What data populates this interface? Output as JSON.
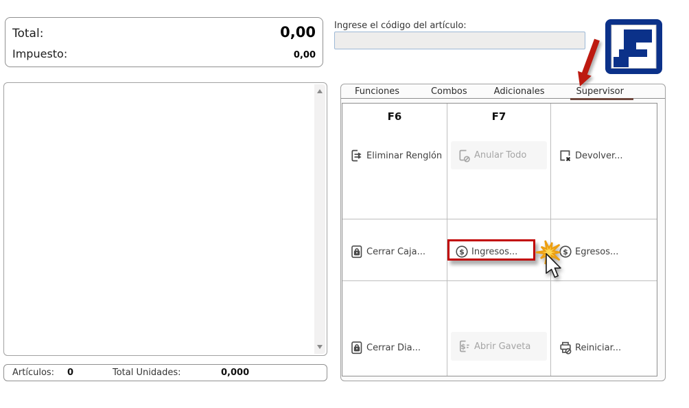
{
  "summary": {
    "total_label": "Total:",
    "total_value": "0,00",
    "tax_label": "Impuesto:",
    "tax_value": "0,00"
  },
  "code_entry": {
    "label": "Ingrese el código del artículo:",
    "value": ""
  },
  "tabs": [
    {
      "label": "Funciones",
      "selected": false
    },
    {
      "label": "Combos",
      "selected": false
    },
    {
      "label": "Adicionales",
      "selected": false
    },
    {
      "label": "Supervisor",
      "selected": true
    }
  ],
  "grid": {
    "rows": [
      {
        "cells": [
          {
            "header": "F6",
            "label": "Eliminar Renglón",
            "icon": "delete-row-icon",
            "disabled": false,
            "highlighted": false
          },
          {
            "header": "F7",
            "label": "Anular Todo",
            "icon": "cancel-document-icon",
            "disabled": true,
            "highlighted": false
          },
          {
            "header": "",
            "label": "Devolver...",
            "icon": "return-document-icon",
            "disabled": false,
            "highlighted": false
          }
        ]
      },
      {
        "cells": [
          {
            "header": "",
            "label": "Cerrar Caja...",
            "icon": "lock-icon",
            "disabled": false,
            "highlighted": false
          },
          {
            "header": "",
            "label": "Ingresos...",
            "icon": "dollar-circle-icon",
            "disabled": false,
            "highlighted": true
          },
          {
            "header": "",
            "label": "Egresos...",
            "icon": "dollar-circle-icon",
            "disabled": false,
            "highlighted": false
          }
        ]
      },
      {
        "cells": [
          {
            "header": "",
            "label": "Cerrar Dia...",
            "icon": "lock-icon",
            "disabled": false,
            "highlighted": false
          },
          {
            "header": "",
            "label": "Abrir Gaveta",
            "icon": "cash-drawer-icon",
            "disabled": true,
            "highlighted": false
          },
          {
            "header": "",
            "label": "Reiniciar...",
            "icon": "printer-cancel-icon",
            "disabled": false,
            "highlighted": false
          }
        ]
      }
    ]
  },
  "status_bar": {
    "articles_label": "Artículos:",
    "articles_value": "0",
    "units_label": "Total Unidades:",
    "units_value": "0,000"
  },
  "annotations": {
    "arrow_icon": "red-arrow-icon",
    "highlight": "red-highlight-box",
    "starburst_icon": "click-starburst-icon",
    "cursor_icon": "mouse-cursor-icon"
  },
  "colors": {
    "brand_navy": "#0b3189",
    "highlight_red": "#c10000",
    "arrow_red": "#bd1a10",
    "tab_underline": "#6e463c",
    "starburst_yellow": "#ffd957",
    "starburst_outline": "#ec9f12",
    "disabled_text": "#a5a5a5",
    "input_bg": "#eeedec",
    "input_border": "#9cb8d6"
  }
}
